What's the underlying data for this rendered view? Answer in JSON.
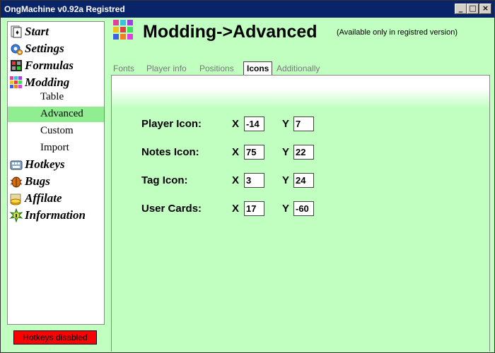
{
  "window": {
    "title": "OngMachine v0.92a Registred",
    "min_symbol": "_",
    "max_symbol": "□",
    "close_symbol": "×"
  },
  "sidebar": {
    "items": [
      {
        "label": "Start",
        "icon": "playing-card-icon"
      },
      {
        "label": "Settings",
        "icon": "gear-icon"
      },
      {
        "label": "Formulas",
        "icon": "calculator-icon"
      },
      {
        "label": "Modding",
        "icon": "color-grid-icon"
      },
      {
        "label": "Hotkeys",
        "icon": "keyboard-icon"
      },
      {
        "label": "Bugs",
        "icon": "bug-icon"
      },
      {
        "label": "Affilate",
        "icon": "handshake-coins-icon"
      },
      {
        "label": "Information",
        "icon": "info-icon"
      }
    ],
    "sub_items": [
      {
        "label": "Table"
      },
      {
        "label": "Advanced",
        "selected": true
      },
      {
        "label": "Custom"
      },
      {
        "label": "Import"
      }
    ],
    "status_badge": "Hotkeys disabled"
  },
  "main": {
    "title": "Modding->Advanced",
    "note": "(Available only in registred version)",
    "tabs": [
      "Fonts",
      "Player info",
      "Positions",
      "Icons",
      "Additionally"
    ],
    "active_tab": "Icons",
    "rows": [
      {
        "label": "Player Icon:",
        "x_label": "X",
        "x": "-14",
        "y_label": "Y",
        "y": "7"
      },
      {
        "label": "Notes Icon:",
        "x_label": "X",
        "x": "75",
        "y_label": "Y",
        "y": "22"
      },
      {
        "label": "Tag Icon:",
        "x_label": "X",
        "x": "3",
        "y_label": "Y",
        "y": "24"
      },
      {
        "label": "User Cards:",
        "x_label": "X",
        "x": "17",
        "y_label": "Y",
        "y": "-60"
      }
    ]
  },
  "colors": {
    "background": "#c0ffc0",
    "selected": "#90ee90",
    "titlebar": "#0a246a",
    "badge": "#ff0000"
  }
}
